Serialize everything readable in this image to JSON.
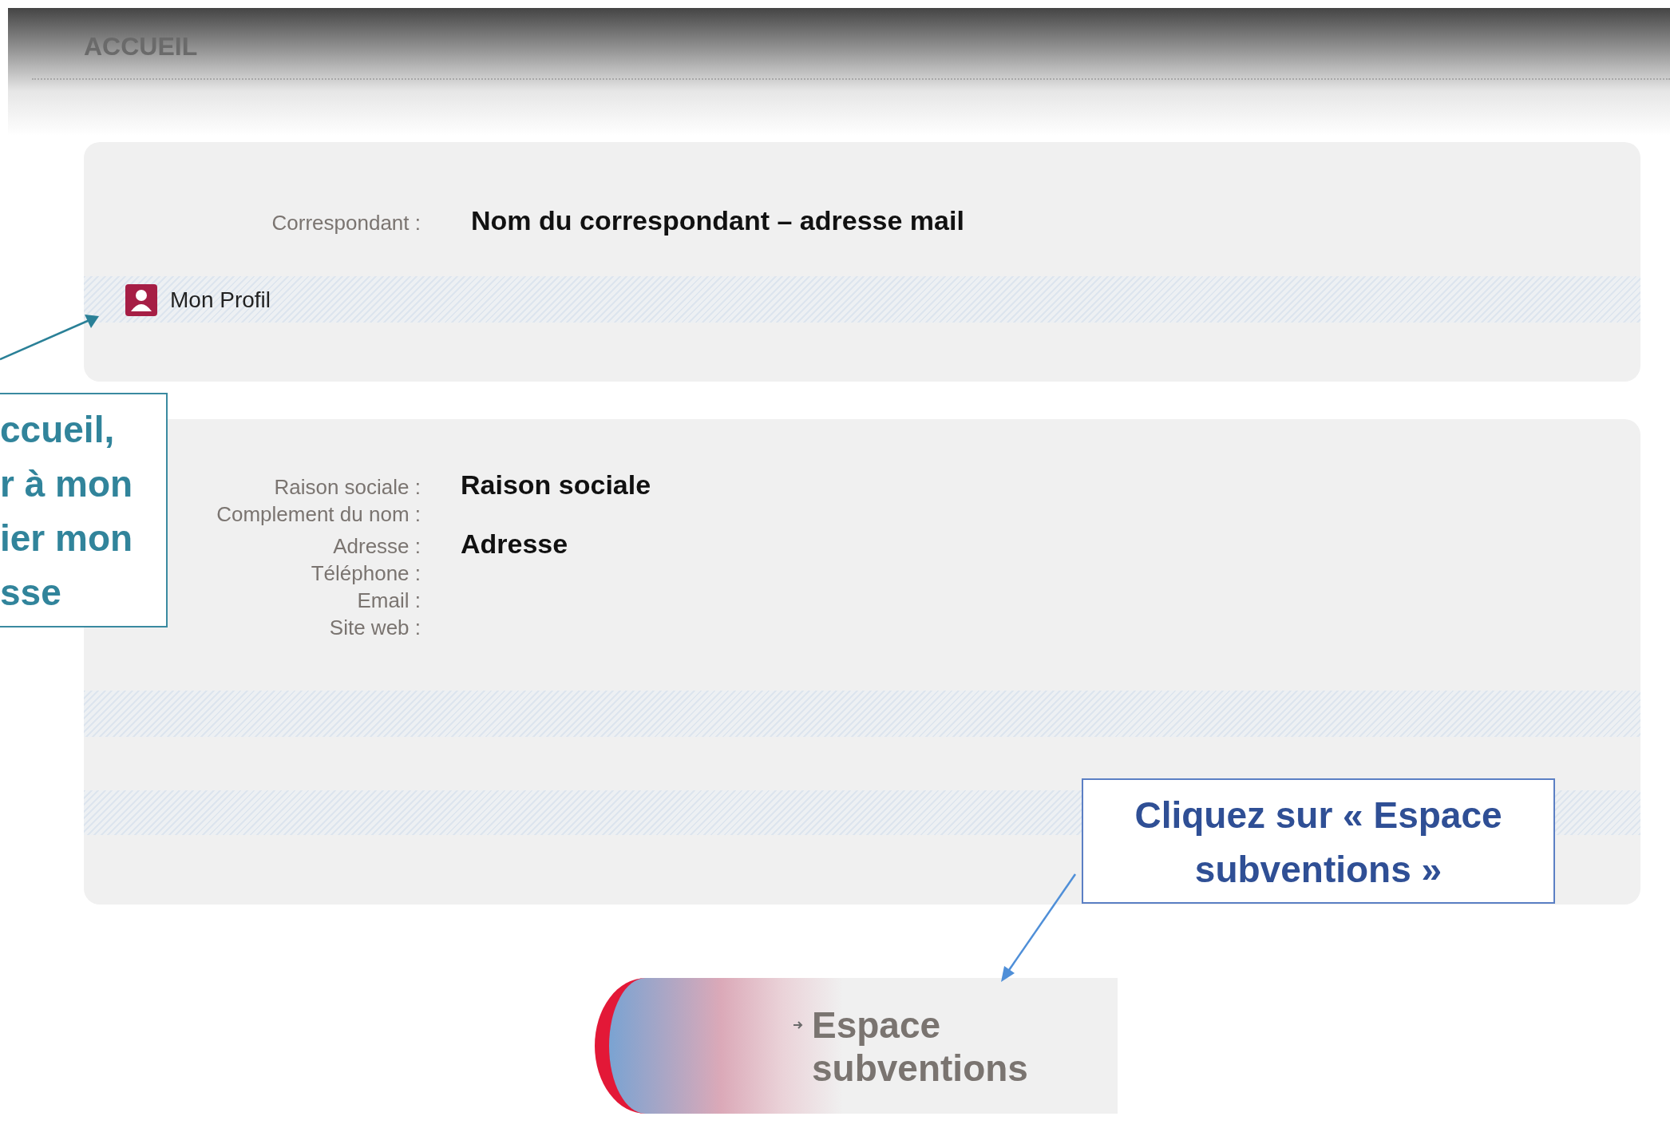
{
  "header": {
    "title": "ACCUEIL"
  },
  "correspondant": {
    "label": "Correspondant :",
    "value": "Nom du correspondant – adresse mail"
  },
  "profile_link": {
    "label": "Mon Profil"
  },
  "organisation": {
    "fields": [
      {
        "label": "Raison sociale :",
        "value": "Raison sociale"
      },
      {
        "label": "Complement du nom :"
      },
      {
        "label": "Adresse :",
        "value": "Adresse"
      },
      {
        "label": "Téléphone :"
      },
      {
        "label": "Email :"
      },
      {
        "label": "Site web :"
      }
    ]
  },
  "callouts": [
    {
      "kind": "left",
      "lines": [
        "ccueil,",
        "r à mon",
        "ier mon",
        "sse"
      ]
    },
    {
      "kind": "right",
      "lines": [
        "Cliquez sur « Espace",
        "subventions »"
      ]
    }
  ],
  "subsidies_button": {
    "label": "Espace subventions"
  }
}
